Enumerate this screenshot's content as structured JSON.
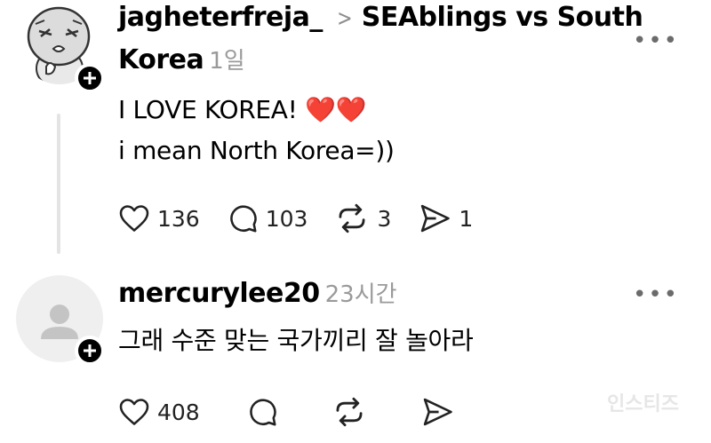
{
  "posts": [
    {
      "username": "jagheterfreja_",
      "separator": ">",
      "thread_title_line1": "SEAblings vs South",
      "thread_title_line2": "Korea",
      "time": "1일",
      "more": "•••",
      "text_lines": [
        "I LOVE KOREA! ❤️❤️",
        "i mean North Korea=))"
      ],
      "likes": "136",
      "comments": "103",
      "reposts": "3",
      "shares": "1"
    },
    {
      "username": "mercurylee20",
      "time": "23시간",
      "more": "•••",
      "text_lines": [
        "그래 수준 맞는 국가끼리 잘 놀아라"
      ],
      "likes": "408"
    }
  ],
  "watermark": "인스티즈",
  "colors": {
    "text": "#000000",
    "muted": "#9a9a9a",
    "heart": "#ff3b62",
    "thread_line": "#e4e4e4",
    "avatar_placeholder": "#efefef"
  },
  "icons": [
    "heart-icon",
    "comment-icon",
    "repost-icon",
    "share-icon",
    "plus-icon",
    "more-icon",
    "person-icon"
  ]
}
